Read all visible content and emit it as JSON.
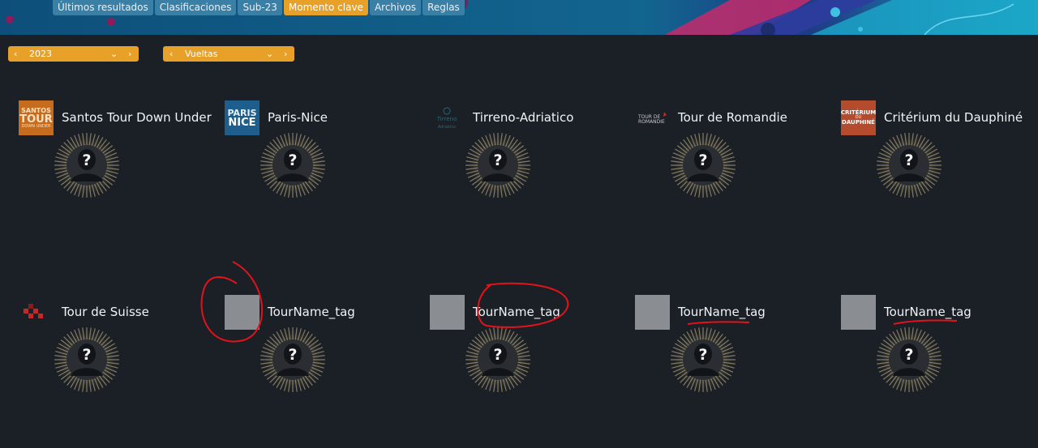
{
  "nav": {
    "tabs": [
      {
        "label": "Últimos resultados",
        "active": false
      },
      {
        "label": "Clasificaciones",
        "active": false
      },
      {
        "label": "Sub-23",
        "active": false
      },
      {
        "label": "Momento clave",
        "active": true
      },
      {
        "label": "Archivos",
        "active": false
      },
      {
        "label": "Reglas",
        "active": false
      }
    ]
  },
  "filters": {
    "year": "2023",
    "category": "Vueltas"
  },
  "tours": [
    {
      "name": "Santos Tour Down Under",
      "logo_text": "SANTOS TOUR DOWN UNDER"
    },
    {
      "name": "Paris-Nice",
      "logo_text": "PARIS NICE"
    },
    {
      "name": "Tirreno-Adriatico",
      "logo_text": "Tirreno Adriatico"
    },
    {
      "name": "Tour de Romandie",
      "logo_text": "TOUR DE ROMANDIE"
    },
    {
      "name": "Critérium du Dauphiné",
      "logo_text": "CRITÉRIUM DU DAUPHINÉ"
    },
    {
      "name": "Tour de Suisse",
      "logo_text": ""
    },
    {
      "name": "TourName_tag",
      "logo_text": ""
    },
    {
      "name": "TourName_tag",
      "logo_text": ""
    },
    {
      "name": "TourName_tag",
      "logo_text": ""
    },
    {
      "name": "TourName_tag",
      "logo_text": ""
    }
  ],
  "emblem_symbol": "?",
  "colors": {
    "accent": "#e7a129",
    "banner": "#0f5a86",
    "tab": "#3a7fa6",
    "background": "#1b1f26",
    "annotation": "#e3121b",
    "placeholder": "#8a8d91"
  }
}
